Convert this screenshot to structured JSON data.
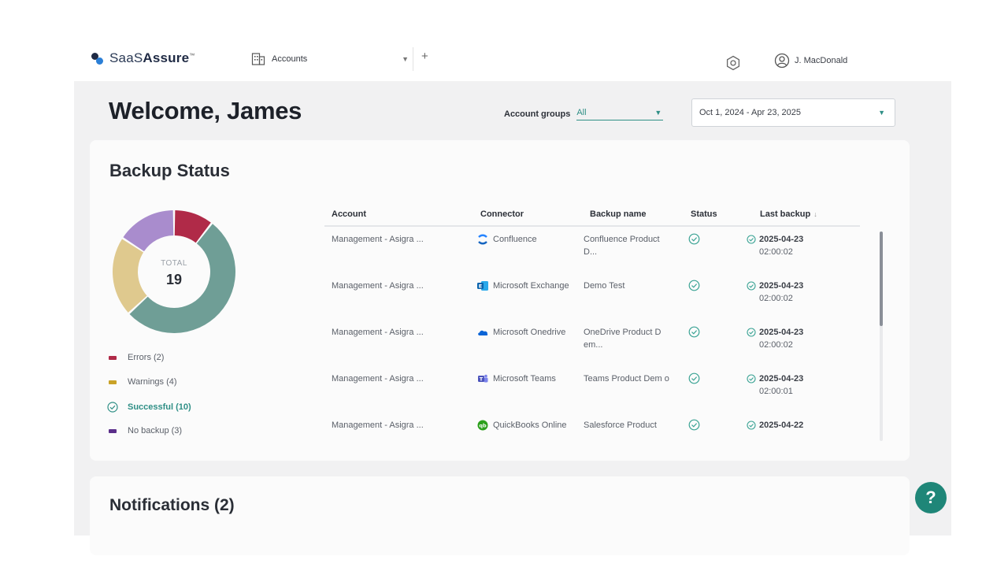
{
  "header": {
    "logo_prefix": "SaaS",
    "logo_bold": "Assure",
    "logo_tm": "™",
    "account_selector": "Accounts",
    "user_name": "J. MacDonald"
  },
  "page": {
    "welcome": "Welcome, James",
    "account_groups_label": "Account groups",
    "account_groups_value": "All",
    "date_range": "Oct 1, 2024 - Apr 23, 2025"
  },
  "backup_status": {
    "title": "Backup Status",
    "total_label": "TOTAL",
    "total_value": "19",
    "chart_data": {
      "type": "pie",
      "categories": [
        "Errors",
        "Warnings",
        "Successful",
        "No backup"
      ],
      "values": [
        2,
        4,
        10,
        3
      ],
      "colors": [
        "#b02a48",
        "#dfc98e",
        "#6f9e96",
        "#a98ccd"
      ]
    },
    "legend": [
      {
        "label": "Errors (2)",
        "color": "#b02a48"
      },
      {
        "label": "Warnings (4)",
        "color": "#c9a227"
      },
      {
        "label": "Successful (10)",
        "color": "#2f8f86"
      },
      {
        "label": "No backup (3)",
        "color": "#5b2f8a"
      }
    ],
    "columns": [
      "Account",
      "Connector",
      "Backup name",
      "Status",
      "Last backup"
    ],
    "sort_indicator": "↓",
    "rows": [
      {
        "account": "Management - Asigra ...",
        "connector": "Confluence",
        "connector_icon": "confluence-icon",
        "backup_name": "Confluence Product D...",
        "date": "2025-04-23",
        "time": "02:00:02"
      },
      {
        "account": "Management - Asigra ...",
        "connector": "Microsoft Exchange",
        "connector_icon": "exchange-icon",
        "backup_name": "Demo Test",
        "date": "2025-04-23",
        "time": "02:00:02"
      },
      {
        "account": "Management - Asigra ...",
        "connector": "Microsoft Onedrive",
        "connector_icon": "onedrive-icon",
        "backup_name": "OneDrive Product D em...",
        "date": "2025-04-23",
        "time": "02:00:02"
      },
      {
        "account": "Management - Asigra ...",
        "connector": "Microsoft Teams",
        "connector_icon": "teams-icon",
        "backup_name": "Teams Product Dem o",
        "date": "2025-04-23",
        "time": "02:00:01"
      },
      {
        "account": "Management - Asigra ...",
        "connector": "QuickBooks Online",
        "connector_icon": "quickbooks-icon",
        "backup_name": "Salesforce Product",
        "date": "2025-04-22",
        "time": ""
      }
    ]
  },
  "notifications": {
    "title": "Notifications (2)"
  },
  "help": {
    "label": "?"
  }
}
